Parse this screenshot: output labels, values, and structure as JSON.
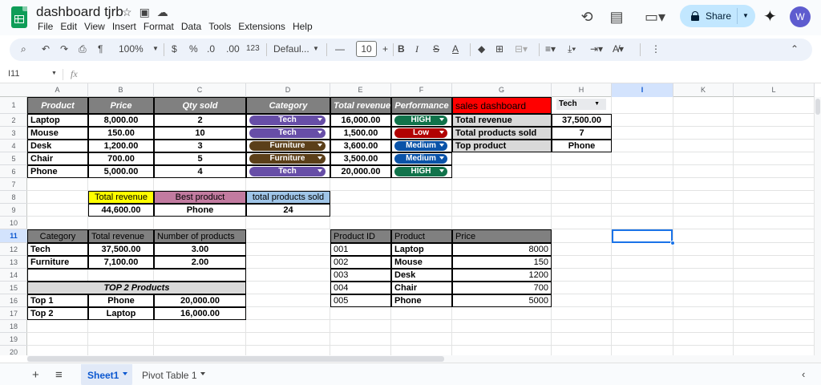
{
  "doc": {
    "title": "dashboard tjrb"
  },
  "menu": [
    "File",
    "Edit",
    "View",
    "Insert",
    "Format",
    "Data",
    "Tools",
    "Extensions",
    "Help"
  ],
  "header": {
    "share_label": "Share",
    "avatar_initial": "W"
  },
  "toolbar": {
    "zoom": "100%",
    "currency": "$",
    "percent": "%",
    "dec_decrease": ".0",
    "dec_increase": ".00",
    "number_format": "123",
    "font": "Defaul...",
    "font_size": "10",
    "minus": "—",
    "plus": "+",
    "bold": "B",
    "italic": "I",
    "strike": "S",
    "text_color": "A"
  },
  "formula": {
    "namebox": "I11",
    "fx": "fx"
  },
  "columns": [
    "A",
    "B",
    "C",
    "D",
    "E",
    "F",
    "G",
    "H",
    "I",
    "K",
    "L"
  ],
  "rows": [
    "1",
    "2",
    "3",
    "4",
    "5",
    "6",
    "7",
    "8",
    "9",
    "10",
    "11",
    "12",
    "13",
    "14",
    "15",
    "16",
    "17",
    "18",
    "19",
    "20"
  ],
  "main_table": {
    "headers": [
      "Product",
      "Price",
      "Qty sold",
      "Category",
      "Total revenue",
      "Performance"
    ],
    "rows": [
      {
        "product": "Laptop",
        "price": "8,000.00",
        "qty": "2",
        "category": "Tech",
        "revenue": "16,000.00",
        "performance": "HIGH"
      },
      {
        "product": "Mouse",
        "price": "150.00",
        "qty": "10",
        "category": "Tech",
        "revenue": "1,500.00",
        "performance": "Low"
      },
      {
        "product": "Desk",
        "price": "1,200.00",
        "qty": "3",
        "category": "Furniture",
        "revenue": "3,600.00",
        "performance": "Medium"
      },
      {
        "product": "Chair",
        "price": "700.00",
        "qty": "5",
        "category": "Furniture",
        "revenue": "3,500.00",
        "performance": "Medium"
      },
      {
        "product": "Phone",
        "price": "5,000.00",
        "qty": "4",
        "category": "Tech",
        "revenue": "20,000.00",
        "performance": "HIGH"
      }
    ]
  },
  "dashboard": {
    "title": "sales dashboard",
    "filter_value": "Tech",
    "labels": [
      "Total revenue",
      "Total products sold",
      "Top product"
    ],
    "values": [
      "37,500.00",
      "7",
      "Phone"
    ]
  },
  "summary": {
    "headers": [
      "Total revenue",
      "Best product",
      "total products sold"
    ],
    "values": [
      "44,600.00",
      "Phone",
      "24"
    ]
  },
  "pivot": {
    "headers": [
      "Category",
      "Total revenue",
      "Number of products"
    ],
    "rows": [
      [
        "Tech",
        "37,500.00",
        "3.00"
      ],
      [
        "Furniture",
        "7,100.00",
        "2.00"
      ]
    ]
  },
  "top2": {
    "title": "TOP 2 Products",
    "rows": [
      [
        "Top 1",
        "Phone",
        "20,000.00"
      ],
      [
        "Top 2",
        "Laptop",
        "16,000.00"
      ]
    ]
  },
  "products": {
    "headers": [
      "Product ID",
      "Product",
      "Price"
    ],
    "rows": [
      [
        "001",
        "Laptop",
        "8000"
      ],
      [
        "002",
        "Mouse",
        "150"
      ],
      [
        "003",
        "Desk",
        "1200"
      ],
      [
        "004",
        "Chair",
        "700"
      ],
      [
        "005",
        "Phone",
        "5000"
      ]
    ]
  },
  "sheets": {
    "active": "Sheet1",
    "other": "Pivot Table 1"
  },
  "colors": {
    "header_gray": "#808080",
    "red": "#ff0000",
    "yellow": "#ffff00",
    "pink": "#c27ba0",
    "blue": "#9fc5e8",
    "light_gray": "#d9d9d9",
    "chip_tech": "#674ea7",
    "chip_furniture": "#5b3f19",
    "chip_high": "#11734b",
    "chip_low": "#b10202",
    "chip_medium": "#0a53a8"
  }
}
